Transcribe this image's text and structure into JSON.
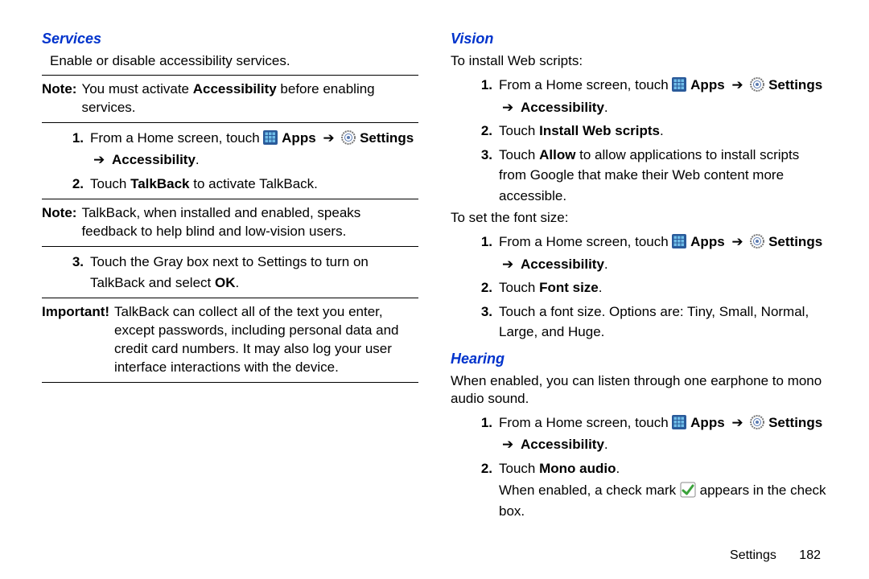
{
  "left": {
    "services_title": "Services",
    "services_desc": "Enable or disable accessibility services.",
    "note1_label": "Note:",
    "note1_a": "You must activate ",
    "note1_b": "Accessibility",
    "note1_c": " before enabling services.",
    "step1_pre": "From a Home screen, touch ",
    "apps_label": "Apps",
    "settings_label": "Settings",
    "accessibility_label": "Accessibility",
    "step2_a": "Touch ",
    "step2_b": "TalkBack",
    "step2_c": " to activate TalkBack.",
    "note2_label": "Note:",
    "note2_body": "TalkBack, when installed and enabled, speaks feedback to help blind and low-vision users.",
    "step3_a": "Touch the Gray box next to Settings to turn on TalkBack and select ",
    "step3_b": "OK",
    "step3_c": ".",
    "important_label": "Important!",
    "important_body": "TalkBack can collect all of the text you enter, except passwords, including personal data and credit card numbers. It may also log your user interface interactions with the device."
  },
  "right": {
    "vision_title": "Vision",
    "vision_intro": "To install Web scripts:",
    "v1_pre": "From a Home screen, touch ",
    "apps_label": "Apps",
    "settings_label": "Settings",
    "accessibility_label": "Accessibility",
    "v2_a": "Touch ",
    "v2_b": "Install Web scripts",
    "v2_c": ".",
    "v3_a": "Touch ",
    "v3_b": "Allow",
    "v3_c": " to allow applications to install scripts from Google that make their Web content more accessible.",
    "font_intro": "To set the font size:",
    "f1_pre": "From a Home screen, touch ",
    "f2_a": "Touch ",
    "f2_b": "Font size",
    "f2_c": ".",
    "f3": "Touch a font size. Options are: Tiny, Small, Normal, Large, and Huge.",
    "hearing_title": "Hearing",
    "hearing_intro": "When enabled, you can listen through one earphone to mono audio sound.",
    "h1_pre": "From a Home screen, touch ",
    "h2_a": "Touch ",
    "h2_b": "Mono audio",
    "h2_c": ".",
    "checkmark_a": "When enabled, a check mark ",
    "checkmark_b": " appears in the check box."
  },
  "nums": {
    "n1": "1.",
    "n2": "2.",
    "n3": "3."
  },
  "arrow": "➔ ",
  "footer": {
    "label": "Settings",
    "page": "182"
  }
}
